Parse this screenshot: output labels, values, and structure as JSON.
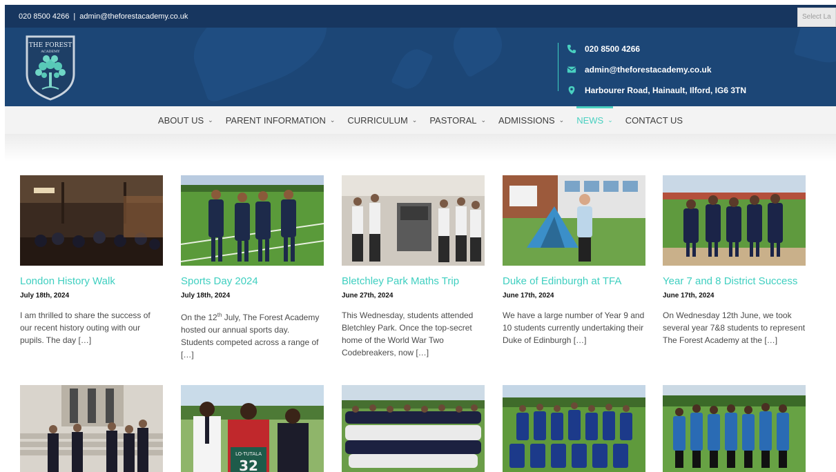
{
  "topbar": {
    "phone": "020 8500 4266",
    "separator": "|",
    "email": "admin@theforestacademy.co.uk",
    "language_select": "Select La"
  },
  "header": {
    "logo_text_top": "THE FOREST",
    "logo_text_bottom": "ACADEMY",
    "contact": {
      "phone": "020 8500 4266",
      "email": "admin@theforestacademy.co.uk",
      "address": "Harbourer Road, Hainault, Ilford, IG6 3TN"
    }
  },
  "nav": {
    "items": [
      {
        "label": "ABOUT US",
        "chevron": "⌄"
      },
      {
        "label": "PARENT INFORMATION",
        "chevron": "⌄"
      },
      {
        "label": "CURRICULUM",
        "chevron": "⌄"
      },
      {
        "label": "PASTORAL",
        "chevron": "⌄"
      },
      {
        "label": "ADMISSIONS",
        "chevron": "⌄"
      },
      {
        "label": "NEWS",
        "chevron": "⌄"
      },
      {
        "label": "CONTACT US"
      }
    ],
    "active": "NEWS"
  },
  "posts": [
    {
      "title": "London History Walk",
      "date": "July 18th, 2024",
      "excerpt": "I am thrilled to share the success of our recent history outing with our pupils. The day […]"
    },
    {
      "title": "Sports Day 2024",
      "date": "July 18th, 2024",
      "excerpt_pre": "On the 12",
      "excerpt_sup": "th",
      "excerpt_post": " July, The Forest Academy hosted our annual sports day. Students competed across a range of […]"
    },
    {
      "title": "Bletchley Park Maths Trip",
      "date": "June 27th, 2024",
      "excerpt": "This Wednesday, students attended Bletchley Park. Once the top-secret home of the World War Two Codebreakers, now […]"
    },
    {
      "title": "Duke of Edinburgh at TFA",
      "date": "June 17th, 2024",
      "excerpt": "We have a large number of Year 9 and 10 students currently undertaking their Duke of Edinburgh […]"
    },
    {
      "title": "Year 7 and 8 District Success",
      "date": "June 17th, 2024",
      "excerpt": "On Wednesday 12th June, we took several year 7&8 students to represent The Forest Academy at the […]"
    }
  ],
  "jersey_text": "LO-TUTALA",
  "jersey_number": "32",
  "colors": {
    "topbar": "#17365f",
    "header": "#1c4676",
    "accent": "#49d0c0",
    "nav_bg": "#f3f3f3"
  }
}
